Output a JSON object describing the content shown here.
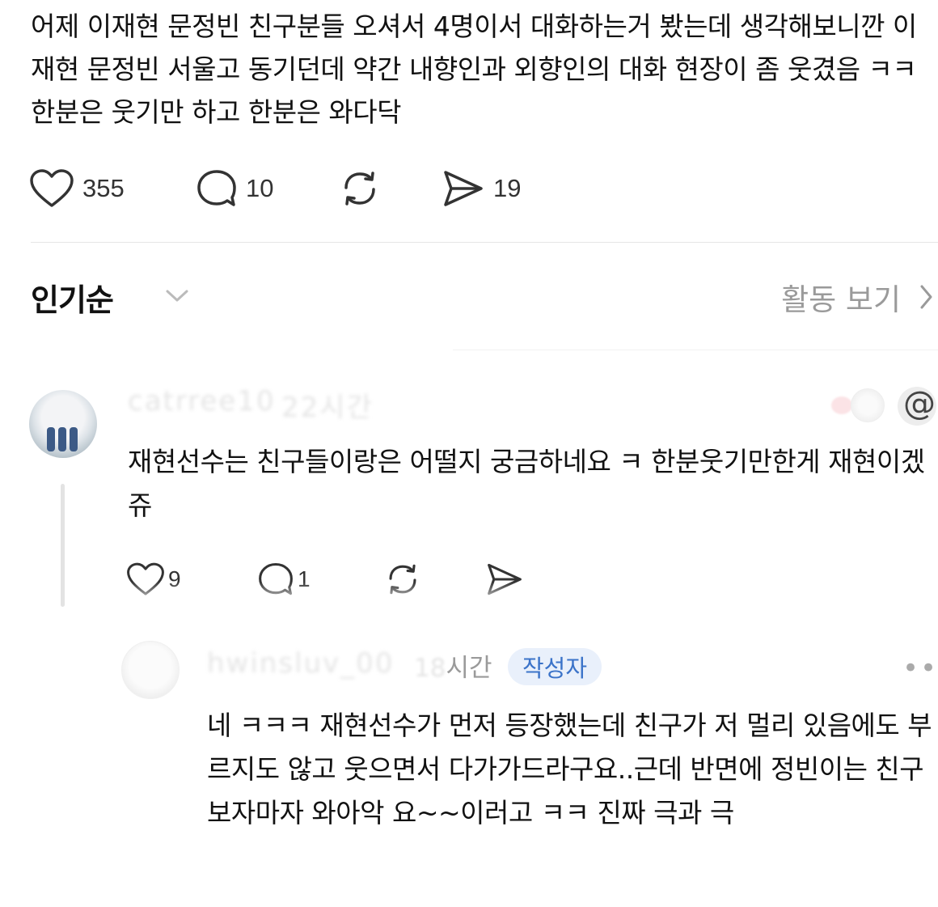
{
  "post": {
    "text": "어제 이재현 문정빈 친구분들 오셔서 4명이서 대화하는거 봤는데 생각해보니깐 이재현 문정빈 서울고 동기던데 약간 내향인과 외향인의 대화 현장이 좀 웃겼음 ㅋㅋ 한분은 웃기만 하고 한분은 와다닥",
    "actions": {
      "like": {
        "icon": "heart-icon",
        "count": "355"
      },
      "comment": {
        "icon": "comment-icon",
        "count": "10"
      },
      "repost": {
        "icon": "repost-icon"
      },
      "share": {
        "icon": "send-icon",
        "count": "19"
      }
    }
  },
  "sort": {
    "label": "인기순",
    "activity_label": "활동 보기"
  },
  "comments": [
    {
      "username": "catrree10",
      "time": "22시간",
      "text": "재현선수는 친구들이랑은 어떨지 궁금하네요 ㅋ 한분웃기만한게 재현이겠쥬",
      "actions": {
        "like_count": "9",
        "comment_count": "1"
      }
    },
    {
      "username": "hwinsluv_00",
      "time_ghost": "18",
      "time_unit": "시간",
      "badge": "작성자",
      "more_label": "•••",
      "text": "네 ㅋㅋㅋ 재현선수가 먼저 등장했는데 친구가 저 멀리 있음에도 부르지도 않고 웃으면서 다가가드라구요..근데 반면에 정빈이는 친구 보자마자 와아악 요~~이러고 ㅋㅋ 진짜 극과 극"
    }
  ],
  "colors": {
    "text": "#111111",
    "muted": "#9a9a9a",
    "badge_bg": "#e9f0fb",
    "badge_text": "#3b73c9",
    "divider": "#e6e6e6"
  }
}
